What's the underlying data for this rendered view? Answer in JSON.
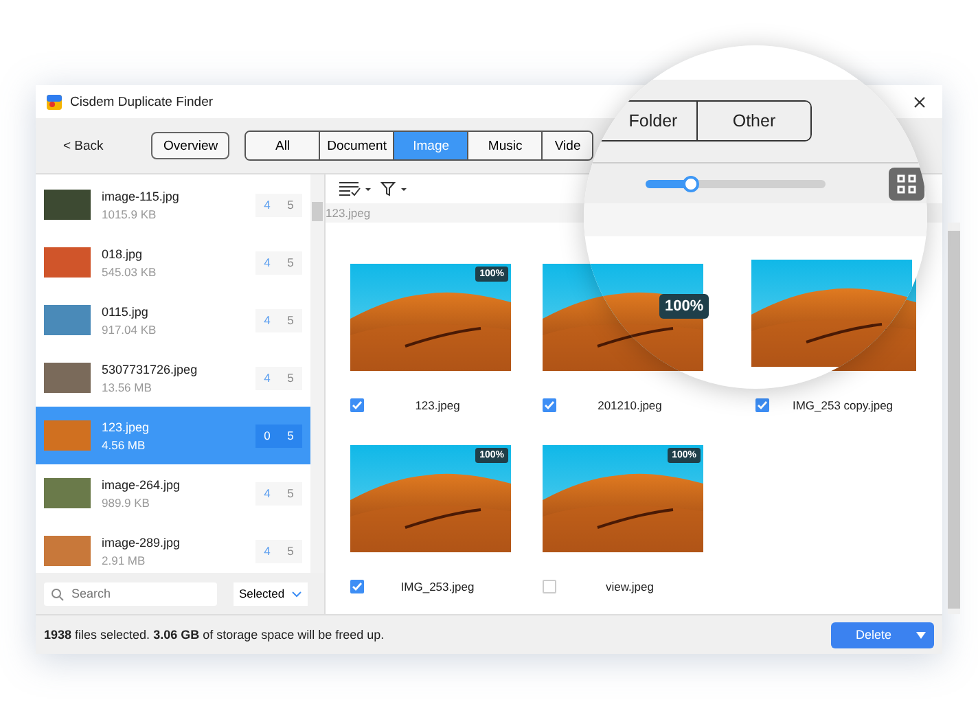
{
  "window": {
    "title": "Cisdem Duplicate Finder"
  },
  "toolbar": {
    "back": "< Back",
    "overview": "Overview",
    "tabs": [
      {
        "label": "All",
        "selected": false
      },
      {
        "label": "Document",
        "selected": false
      },
      {
        "label": "Image",
        "selected": true
      },
      {
        "label": "Music",
        "selected": false
      },
      {
        "label": "Vide",
        "selected": false
      }
    ]
  },
  "sidebar": {
    "items": [
      {
        "name": "image-115.jpg",
        "size": "1015.9 KB",
        "count_a": "4",
        "count_b": "5",
        "selected": false,
        "color": "#3d4a32"
      },
      {
        "name": "018.jpg",
        "size": "545.03 KB",
        "count_a": "4",
        "count_b": "5",
        "selected": false,
        "color": "#d0552a"
      },
      {
        "name": "0115.jpg",
        "size": "917.04 KB",
        "count_a": "4",
        "count_b": "5",
        "selected": false,
        "color": "#4a8ab8"
      },
      {
        "name": "5307731726.jpeg",
        "size": "13.56 MB",
        "count_a": "4",
        "count_b": "5",
        "selected": false,
        "color": "#7a6a5a"
      },
      {
        "name": "123.jpeg",
        "size": "4.56 MB",
        "count_a": "0",
        "count_b": "5",
        "selected": true,
        "color": "#d07020"
      },
      {
        "name": "image-264.jpg",
        "size": "989.9 KB",
        "count_a": "4",
        "count_b": "5",
        "selected": false,
        "color": "#6a7a4a"
      },
      {
        "name": "image-289.jpg",
        "size": "2.91 MB",
        "count_a": "4",
        "count_b": "5",
        "selected": false,
        "color": "#c8783a"
      }
    ],
    "search": {
      "placeholder": "Search"
    },
    "filter": "Selected"
  },
  "content": {
    "path": "123.jpeg",
    "items": [
      {
        "name": "123.jpeg",
        "checked": true,
        "badge": "100%"
      },
      {
        "name": "201210.jpeg",
        "checked": true
      },
      {
        "name": "IMG_253 copy.jpeg",
        "checked": true
      },
      {
        "name": "IMG_253.jpeg",
        "checked": true,
        "badge": "100%"
      },
      {
        "name": "view.jpeg",
        "checked": false,
        "badge": "100%"
      }
    ]
  },
  "magnifier": {
    "tabs": [
      {
        "label": "Folder",
        "selected": false
      },
      {
        "label": "Other",
        "selected": false
      }
    ],
    "slider": {
      "level": 0.25
    },
    "badge": "100%"
  },
  "status_bar": {
    "text": "**1938** files selected. **3.06 GB** of storage space will be freed up.",
    "delete": "Delete"
  }
}
